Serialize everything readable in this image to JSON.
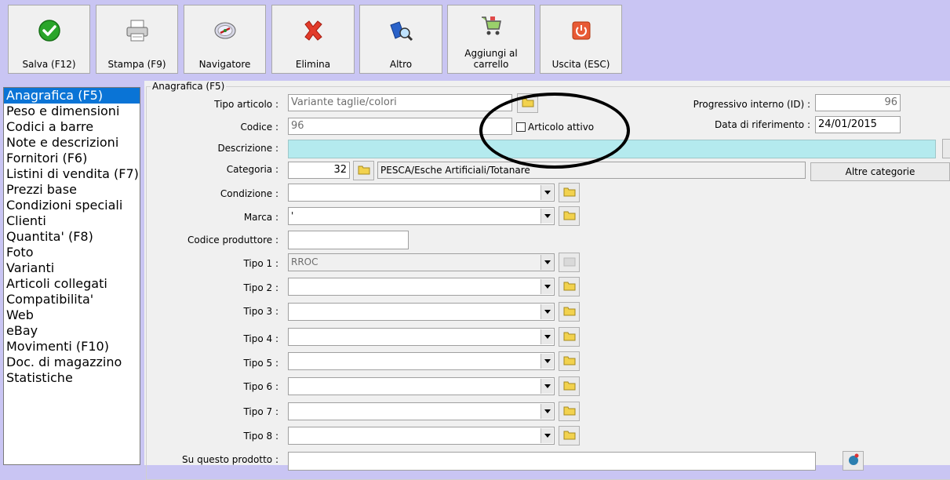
{
  "toolbar": {
    "buttons": [
      {
        "label": "Salva (F12)",
        "icon": "check-icon"
      },
      {
        "label": "Stampa (F9)",
        "icon": "printer-icon"
      },
      {
        "label": "Navigatore",
        "icon": "compass-icon"
      },
      {
        "label": "Elimina",
        "icon": "delete-x-icon"
      },
      {
        "label": "Altro",
        "icon": "book-magnifier-icon"
      },
      {
        "label": "Aggiungi al carrello",
        "icon": "shopping-cart-icon"
      },
      {
        "label": "Uscita (ESC)",
        "icon": "power-icon"
      }
    ]
  },
  "sidebar": {
    "items": [
      "Anagrafica (F5)",
      "Peso e dimensioni",
      "Codici a barre",
      "Note e descrizioni",
      "Fornitori (F6)",
      "Listini di vendita (F7)",
      "Prezzi base",
      "Condizioni speciali",
      "Clienti",
      "Quantita' (F8)",
      "Foto",
      "Varianti",
      "Articoli collegati",
      "Compatibilita'",
      "Web",
      "eBay",
      "Movimenti (F10)",
      "Doc. di magazzino",
      "Statistiche"
    ],
    "selected_index": 0
  },
  "form": {
    "group_title": "Anagrafica (F5)",
    "tipo_articolo": {
      "label": "Tipo articolo :",
      "value": "Variante taglie/colori"
    },
    "codice": {
      "label": "Codice :",
      "value": "96"
    },
    "articolo_attivo": {
      "label": "Articolo attivo",
      "checked": false
    },
    "progressivo": {
      "label": "Progressivo interno (ID) :",
      "value": "96"
    },
    "data_riferimento": {
      "label": "Data di riferimento :",
      "value": "24/01/2015"
    },
    "descrizione": {
      "label": "Descrizione :",
      "value": ""
    },
    "categoria": {
      "label": "Categoria :",
      "code": "32",
      "path": "PESCA/Esche Artificiali/Totanare"
    },
    "altre_categorie": "Altre categorie",
    "condizione": {
      "label": "Condizione :",
      "value": ""
    },
    "marca": {
      "label": "Marca :",
      "value": "'"
    },
    "codice_produttore": {
      "label": "Codice produttore :",
      "value": ""
    },
    "tipi": [
      {
        "label": "Tipo 1 :",
        "value": "RROC"
      },
      {
        "label": "Tipo 2 :",
        "value": ""
      },
      {
        "label": "Tipo 3 :",
        "value": ""
      },
      {
        "label": "Tipo 4 :",
        "value": ""
      },
      {
        "label": "Tipo 5 :",
        "value": ""
      },
      {
        "label": "Tipo 6 :",
        "value": ""
      },
      {
        "label": "Tipo 7 :",
        "value": ""
      },
      {
        "label": "Tipo 8 :",
        "value": ""
      }
    ],
    "su_questo_prodotto": {
      "label": "Su questo prodotto :",
      "value": ""
    }
  },
  "colors": {
    "background": "#c9c5f3",
    "selection": "#0a74d6",
    "description_fill": "#b4eaee",
    "folder": "#f2d24e"
  }
}
